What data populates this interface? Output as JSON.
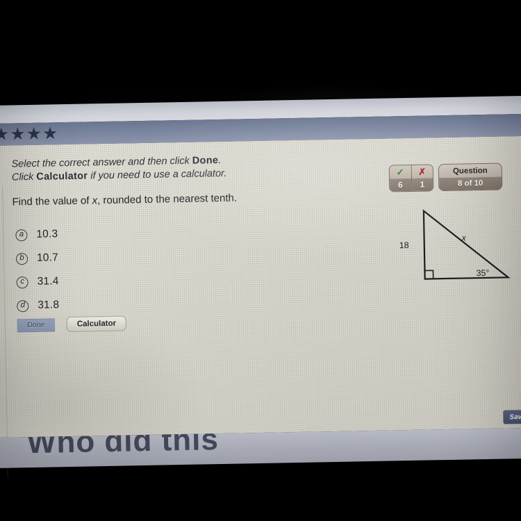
{
  "header": {
    "stars": [
      "★",
      "★",
      "★",
      "★"
    ],
    "star_count": 4,
    "bar_color": "#78839d"
  },
  "instructions": {
    "line1_part1": "Select the correct answer and then click ",
    "line1_bold": "Done",
    "line1_part2": ".",
    "line2_part1": "Click ",
    "line2_bold": "Calculator",
    "line2_part2": " if you need to use a calculator."
  },
  "question": {
    "prompt_part1": "Find the value of ",
    "prompt_var": "x",
    "prompt_part2": ", rounded to the nearest tenth.",
    "choices": [
      {
        "letter": "a",
        "value": "10.3"
      },
      {
        "letter": "b",
        "value": "10.7"
      },
      {
        "letter": "c",
        "value": "31.4"
      },
      {
        "letter": "d",
        "value": "31.8"
      }
    ]
  },
  "buttons": {
    "done_label": "Done",
    "calculator_label": "Calculator",
    "save_label": "Save"
  },
  "score": {
    "correct_icon": "✓",
    "correct_count": "6",
    "wrong_icon": "✗",
    "wrong_count": "1",
    "question_label": "Question",
    "question_progress": "8 of 10",
    "correct_color": "#1f7a2e",
    "wrong_color": "#a82020"
  },
  "figure": {
    "type": "right-triangle",
    "vertical_leg_label": "18",
    "hypotenuse_label": "x",
    "angle_label": "35°",
    "right_angle_marker": true,
    "stroke_color": "#1b1e22"
  },
  "footer": {
    "cut_caption": "Who did this"
  }
}
